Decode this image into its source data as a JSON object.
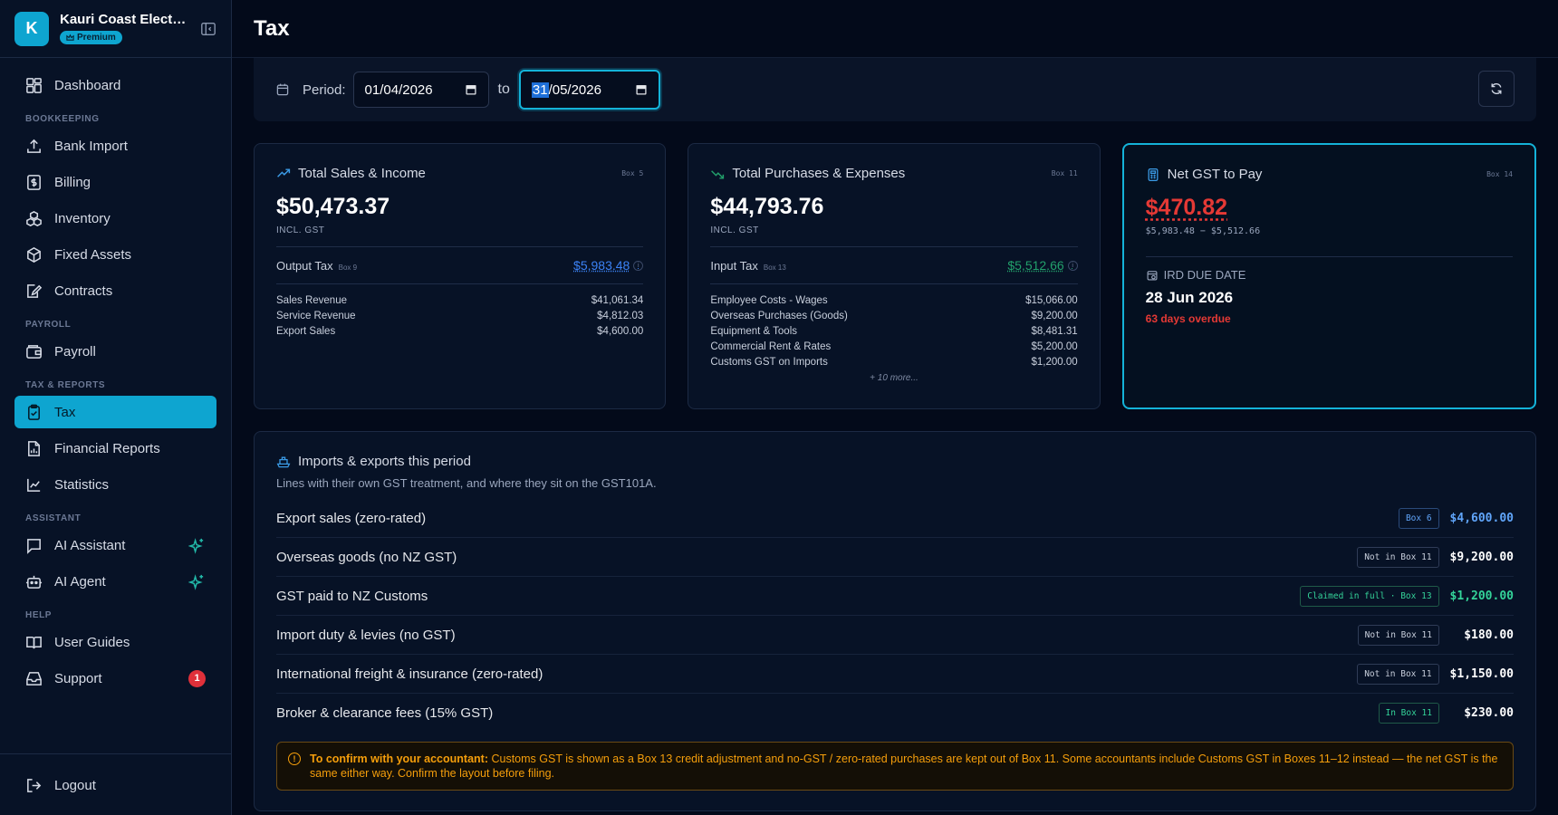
{
  "org": {
    "name": "Kauri Coast Electri...",
    "initial": "K",
    "plan": "Premium"
  },
  "nav": {
    "dashboard": "Dashboard",
    "sections": {
      "bookkeeping": "BOOKKEEPING",
      "payroll": "PAYROLL",
      "tax_reports": "TAX & REPORTS",
      "assistant": "ASSISTANT",
      "help": "HELP"
    },
    "bank_import": "Bank Import",
    "billing": "Billing",
    "inventory": "Inventory",
    "fixed_assets": "Fixed Assets",
    "contracts": "Contracts",
    "payroll": "Payroll",
    "tax": "Tax",
    "financial_reports": "Financial Reports",
    "statistics": "Statistics",
    "ai_assistant": "AI Assistant",
    "ai_agent": "AI Agent",
    "user_guides": "User Guides",
    "support": "Support",
    "support_badge": "1",
    "logout": "Logout"
  },
  "page": {
    "title": "Tax"
  },
  "period": {
    "label": "Period:",
    "from": "01/04/2026",
    "to_sep": "to",
    "to_selected": "31",
    "to_rest": "/05/2026"
  },
  "sales": {
    "title": "Total Sales & Income",
    "box": "Box 5",
    "total": "$50,473.37",
    "incl": "INCL. GST",
    "tax_label": "Output Tax",
    "tax_box": "Box 9",
    "tax_value": "$5,983.48",
    "lines": [
      {
        "label": "Sales Revenue",
        "value": "$41,061.34"
      },
      {
        "label": "Service Revenue",
        "value": "$4,812.03"
      },
      {
        "label": "Export Sales",
        "value": "$4,600.00"
      }
    ]
  },
  "purchases": {
    "title": "Total Purchases & Expenses",
    "box": "Box 11",
    "total": "$44,793.76",
    "incl": "INCL. GST",
    "tax_label": "Input Tax",
    "tax_box": "Box 13",
    "tax_value": "$5,512.66",
    "lines": [
      {
        "label": "Employee Costs - Wages",
        "value": "$15,066.00"
      },
      {
        "label": "Overseas Purchases (Goods)",
        "value": "$9,200.00"
      },
      {
        "label": "Equipment & Tools",
        "value": "$8,481.31"
      },
      {
        "label": "Commercial Rent & Rates",
        "value": "$5,200.00"
      },
      {
        "label": "Customs GST on Imports",
        "value": "$1,200.00"
      }
    ],
    "more": "+ 10 more..."
  },
  "net_gst": {
    "title": "Net GST to Pay",
    "box": "Box 14",
    "amount": "$470.82",
    "formula": "$5,983.48 − $5,512.66",
    "due_label": "IRD DUE DATE",
    "due_date": "28 Jun 2026",
    "overdue": "63 days overdue"
  },
  "imports": {
    "title": "Imports & exports this period",
    "subtitle": "Lines with their own GST treatment, and where they sit on the GST101A.",
    "rows": [
      {
        "label": "Export sales (zero-rated)",
        "tag": "Box 6",
        "amount": "$4,600.00"
      },
      {
        "label": "Overseas goods (no NZ GST)",
        "tag": "Not in Box 11",
        "amount": "$9,200.00"
      },
      {
        "label": "GST paid to NZ Customs",
        "tag": "Claimed in full · Box 13",
        "amount": "$1,200.00"
      },
      {
        "label": "Import duty & levies (no GST)",
        "tag": "Not in Box 11",
        "amount": "$180.00"
      },
      {
        "label": "International freight & insurance (zero-rated)",
        "tag": "Not in Box 11",
        "amount": "$1,150.00"
      },
      {
        "label": "Broker & clearance fees (15% GST)",
        "tag": "In Box 11",
        "amount": "$230.00"
      }
    ],
    "notice_bold": "To confirm with your accountant:",
    "notice_text": " Customs GST is shown as a Box 13 credit adjustment and no-GST / zero-rated purchases are kept out of Box 11. Some accountants include Customs GST in Boxes 11–12 instead — the net GST is the same either way. Confirm the layout before filing."
  },
  "colors": {
    "accent": "#0ea5d0",
    "danger": "#e53935",
    "success": "#22a06b",
    "link": "#3b82f6",
    "warning": "#f59e0b"
  }
}
